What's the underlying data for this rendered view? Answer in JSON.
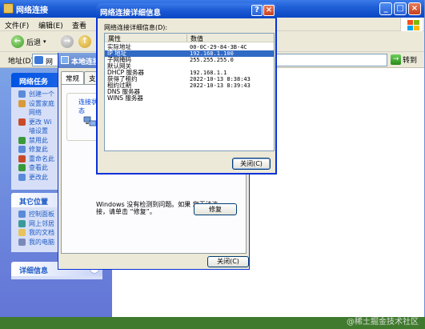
{
  "explorer": {
    "title": "网络连接",
    "menu": [
      "文件(F)",
      "编辑(E)",
      "查看"
    ],
    "back_label": "后退",
    "address_label": "地址(D)",
    "address_value": "网",
    "go_label": "转到"
  },
  "left_panel": {
    "network_tasks_title": "网络任务",
    "network_tasks": [
      "创建一个",
      "设置家庭",
      "网络",
      "更改 Wi",
      "墙设置",
      "禁用此",
      "修复此",
      "重命名此",
      "查看此",
      "更改此"
    ],
    "other_places_title": "其它位置",
    "other_places": [
      "控制面板",
      "网上邻居",
      "我的文档",
      "我的电脑"
    ],
    "details_title": "详细信息"
  },
  "status_dialog": {
    "title": "本地连接",
    "tabs": [
      "常规",
      "支"
    ],
    "group_label": "连接状态",
    "message": "Windows 没有检测到问题。如果 您无法连接，请单击 “修复”。",
    "repair_label": "修复",
    "close_label": "关闭(C)"
  },
  "details_dialog": {
    "title": "网络连接详细信息",
    "list_label": "网络连接详细信息(D):",
    "col_property": "属性",
    "col_value": "数值",
    "rows": [
      {
        "p": "实际地址",
        "v": "00-0C-29-84-3B-4C"
      },
      {
        "p": "IP 地址",
        "v": "192.168.1.100"
      },
      {
        "p": "子网掩码",
        "v": "255.255.255.0"
      },
      {
        "p": "默认网关",
        "v": ""
      },
      {
        "p": "DHCP 服务器",
        "v": "192.168.1.1"
      },
      {
        "p": "获得了租约",
        "v": "2022-10-13 8:38:43"
      },
      {
        "p": "租约过期",
        "v": "2022-10-13 8:39:43"
      },
      {
        "p": "DNS 服务器",
        "v": ""
      },
      {
        "p": "WINS 服务器",
        "v": ""
      }
    ],
    "close_label": "关闭(C)"
  },
  "watermark": "@稀土掘金技术社区"
}
